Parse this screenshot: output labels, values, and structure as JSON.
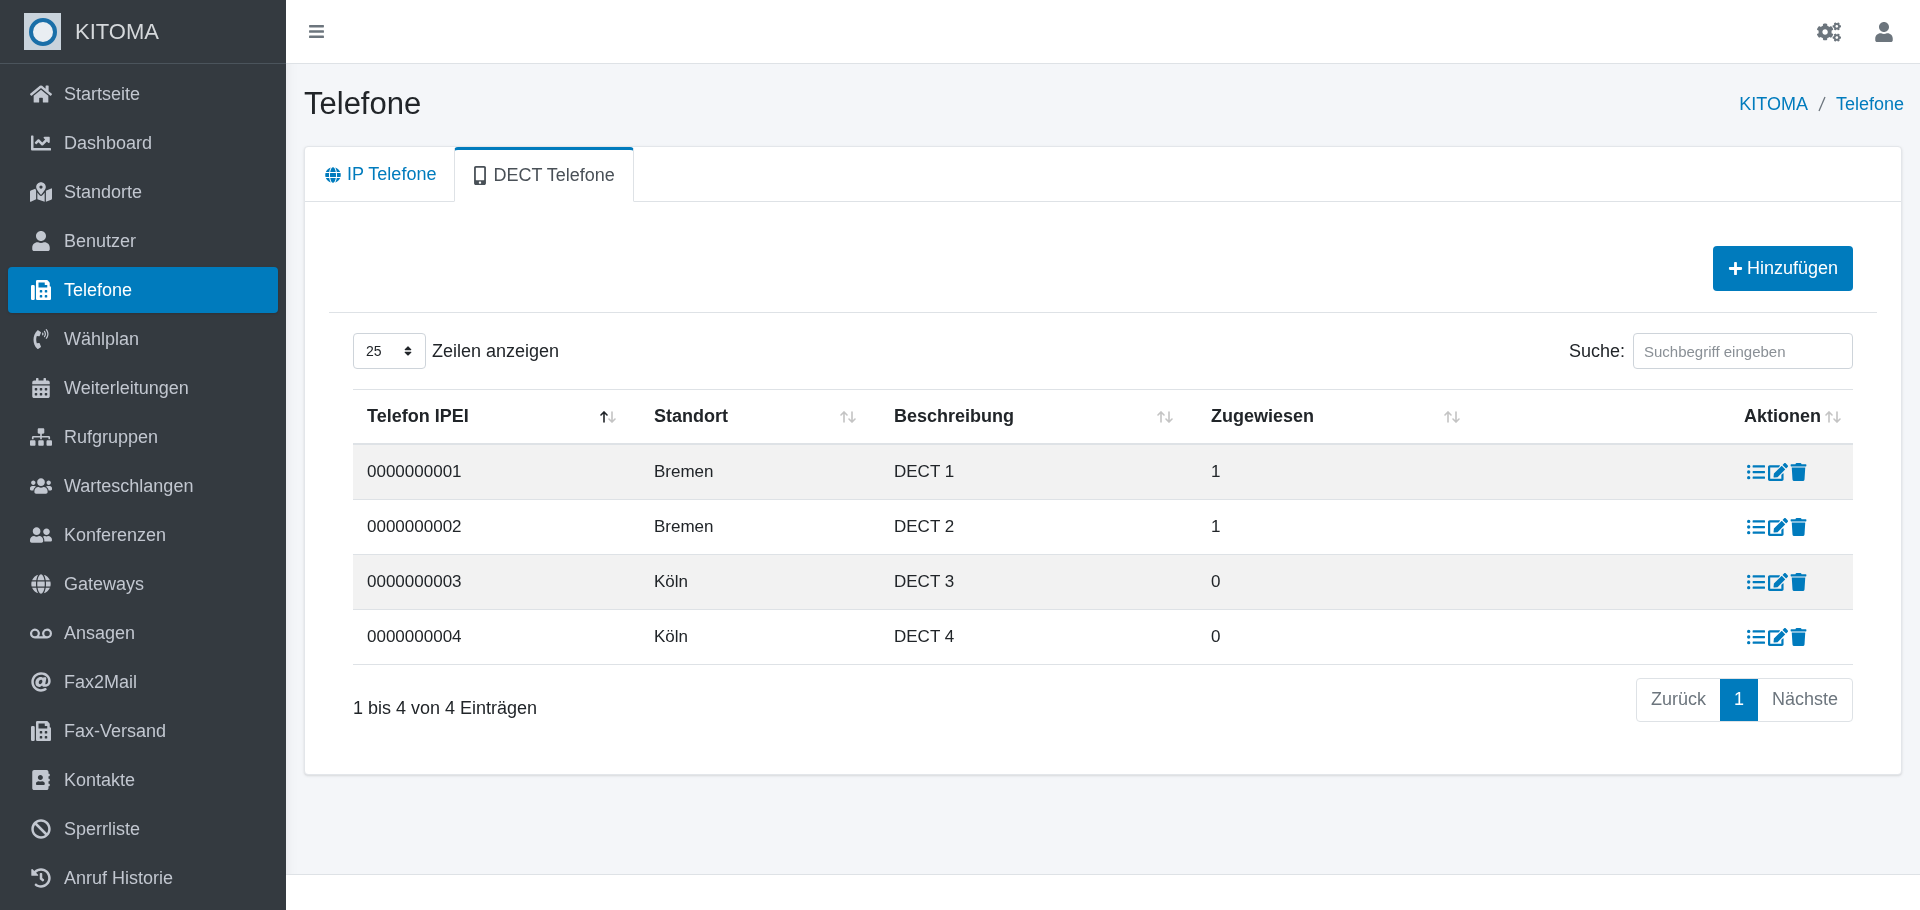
{
  "brand": {
    "name": "KITOMA"
  },
  "sidebar": {
    "items": [
      {
        "label": "Startseite",
        "selected": false
      },
      {
        "label": "Dashboard",
        "selected": false
      },
      {
        "label": "Standorte",
        "selected": false
      },
      {
        "label": "Benutzer",
        "selected": false
      },
      {
        "label": "Telefone",
        "selected": true
      },
      {
        "label": "Wählplan",
        "selected": false
      },
      {
        "label": "Weiterleitungen",
        "selected": false
      },
      {
        "label": "Rufgruppen",
        "selected": false
      },
      {
        "label": "Warteschlangen",
        "selected": false
      },
      {
        "label": "Konferenzen",
        "selected": false
      },
      {
        "label": "Gateways",
        "selected": false
      },
      {
        "label": "Ansagen",
        "selected": false
      },
      {
        "label": "Fax2Mail",
        "selected": false
      },
      {
        "label": "Fax-Versand",
        "selected": false
      },
      {
        "label": "Kontakte",
        "selected": false
      },
      {
        "label": "Sperrliste",
        "selected": false
      },
      {
        "label": "Anruf Historie",
        "selected": false
      }
    ]
  },
  "page": {
    "title": "Telefone",
    "breadcrumb": [
      "KITOMA",
      "Telefone"
    ]
  },
  "tabs": [
    {
      "label": "IP Telefone",
      "selected": false
    },
    {
      "label": "DECT Telefone",
      "selected": true
    }
  ],
  "add_button": "Hinzufügen",
  "length": {
    "value": "25",
    "label": "Zeilen anzeigen"
  },
  "search": {
    "label": "Suche:",
    "placeholder": "Suchbegriff eingeben"
  },
  "table": {
    "columns": [
      {
        "label": "Telefon IPEI",
        "sorted": true
      },
      {
        "label": "Standort",
        "sorted": false
      },
      {
        "label": "Beschreibung",
        "sorted": false
      },
      {
        "label": "Zugewiesen",
        "sorted": false
      },
      {
        "label": "Aktionen",
        "sorted": false
      }
    ],
    "rows": [
      [
        "0000000001",
        "Bremen",
        "DECT 1",
        "1"
      ],
      [
        "0000000002",
        "Bremen",
        "DECT 2",
        "1"
      ],
      [
        "0000000003",
        "Köln",
        "DECT 3",
        "0"
      ],
      [
        "0000000004",
        "Köln",
        "DECT 4",
        "0"
      ]
    ]
  },
  "info": "1 bis 4 von 4 Einträgen",
  "pagination": {
    "previous": "Zurück",
    "pages": [
      {
        "label": "1",
        "selected": true
      }
    ],
    "next": "Nächste"
  }
}
